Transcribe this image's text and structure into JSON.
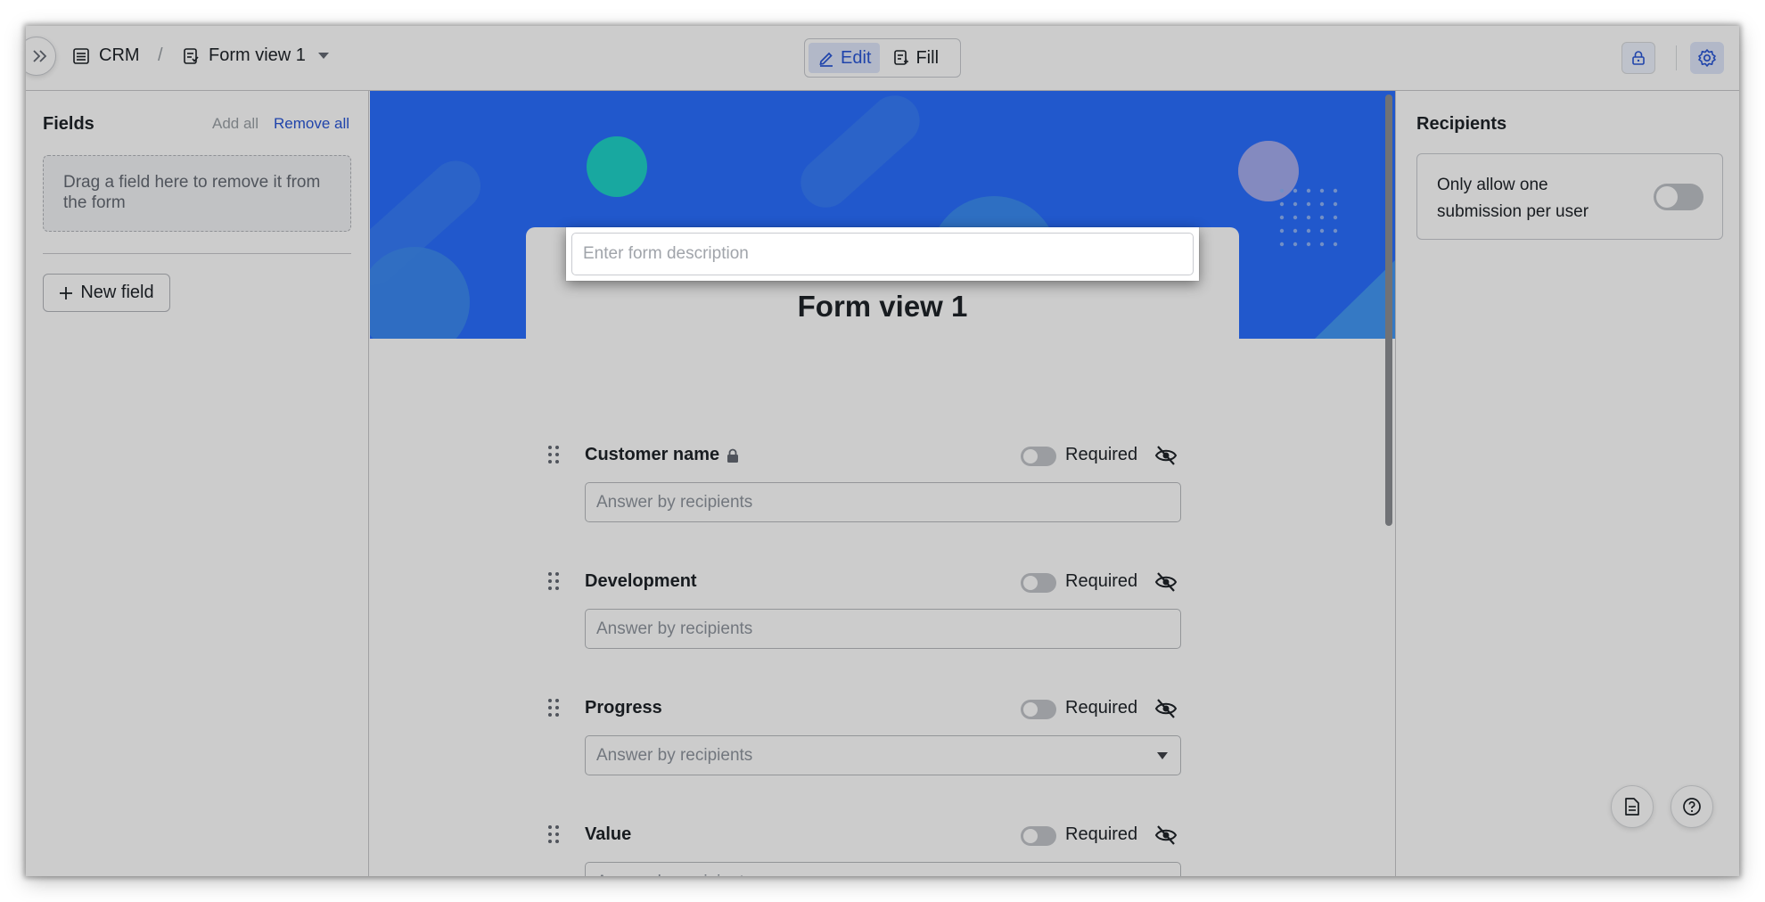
{
  "breadcrumb": {
    "base": "CRM",
    "separator": "/",
    "view": "Form view 1"
  },
  "mode": {
    "edit_label": "Edit",
    "fill_label": "Fill",
    "active": "edit"
  },
  "colors": {
    "accent": "#2856d6",
    "banner": "#2a6fff",
    "dim_overlay": "rgba(0,0,0,0.2)"
  },
  "left": {
    "title": "Fields",
    "add_all": "Add all",
    "remove_all": "Remove all",
    "drop_hint": "Drag a field here to remove it from the form",
    "new_field": "New field"
  },
  "form": {
    "title": "Form view 1",
    "description_placeholder": "Enter form description",
    "fields": [
      {
        "label": "Customer name",
        "locked": true,
        "required_label": "Required",
        "placeholder": "Answer by recipients",
        "type": "text"
      },
      {
        "label": "Development",
        "locked": false,
        "required_label": "Required",
        "placeholder": "Answer by recipients",
        "type": "text"
      },
      {
        "label": "Progress",
        "locked": false,
        "required_label": "Required",
        "placeholder": "Answer by recipients",
        "type": "select"
      },
      {
        "label": "Value",
        "locked": false,
        "required_label": "Required",
        "placeholder": "Answer by recipients",
        "type": "text"
      }
    ]
  },
  "right": {
    "title": "Recipients",
    "option_label": "Only allow one submission per user",
    "option_enabled": false
  }
}
